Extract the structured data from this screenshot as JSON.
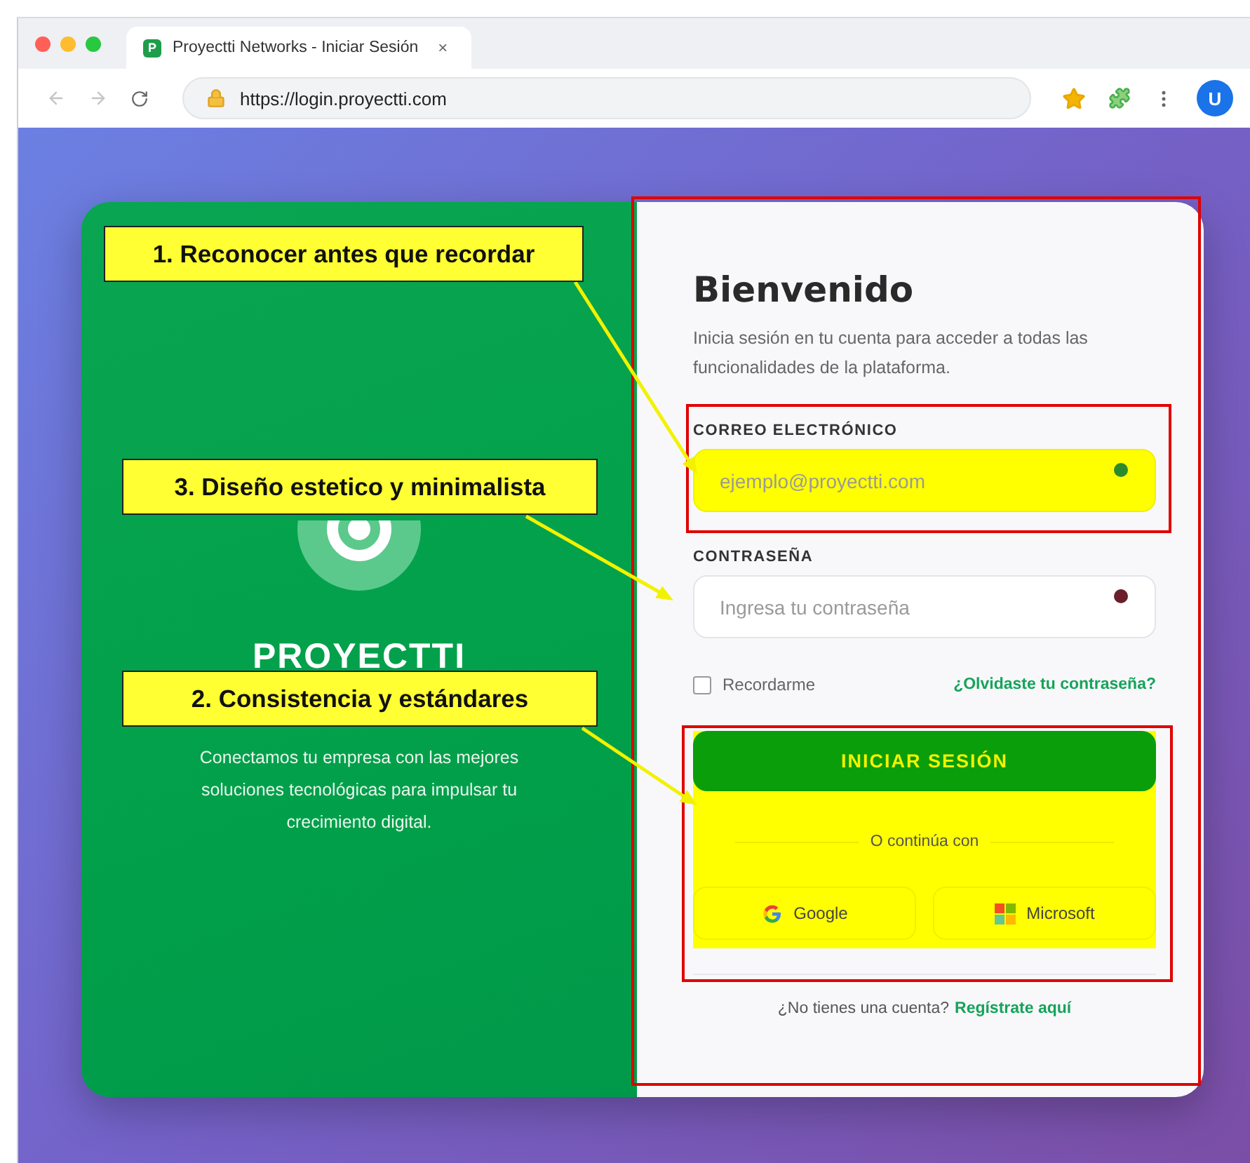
{
  "browser": {
    "tab_icon_letter": "P",
    "tab_title": "Proyectti Networks - Iniciar Sesión",
    "tab_close": "×",
    "url": "https://login.proyectti.com",
    "avatar": "U"
  },
  "brand": {
    "name": "PROYECTTI",
    "tagline": "Conectamos tu empresa con las mejores soluciones tecnológicas para impulsar tu crecimiento digital."
  },
  "login": {
    "title": "Bienvenido",
    "subtitle": "Inicia sesión en tu cuenta para acceder a todas las funcionalidades de la plataforma.",
    "fields": [
      {
        "label": "CORREO ELECTRÓNICO",
        "placeholder": "ejemplo@proyectti.com",
        "kind": "email",
        "highlighted": true
      },
      {
        "label": "CONTRASEÑA",
        "placeholder": "Ingresa tu contraseña",
        "kind": "password",
        "highlighted": false
      }
    ],
    "remember": {
      "label": "Recordarme",
      "checked": false
    },
    "forgot_link": "¿Olvidaste tu contraseña?",
    "submit": "INICIAR SESIÓN",
    "actions_highlighted": true,
    "divider": "O continúa con",
    "social": [
      {
        "label": "Google",
        "kind": "google"
      },
      {
        "label": "Microsoft",
        "kind": "microsoft"
      }
    ],
    "signup_prompt": "¿No tienes una cuenta?",
    "signup_link": "Regístrate aquí"
  },
  "annotations": [
    {
      "text": "1. Reconocer antes que recordar"
    },
    {
      "text": "3. Diseño estetico y minimalista"
    },
    {
      "text": "2. Consistencia y estándares"
    }
  ]
}
